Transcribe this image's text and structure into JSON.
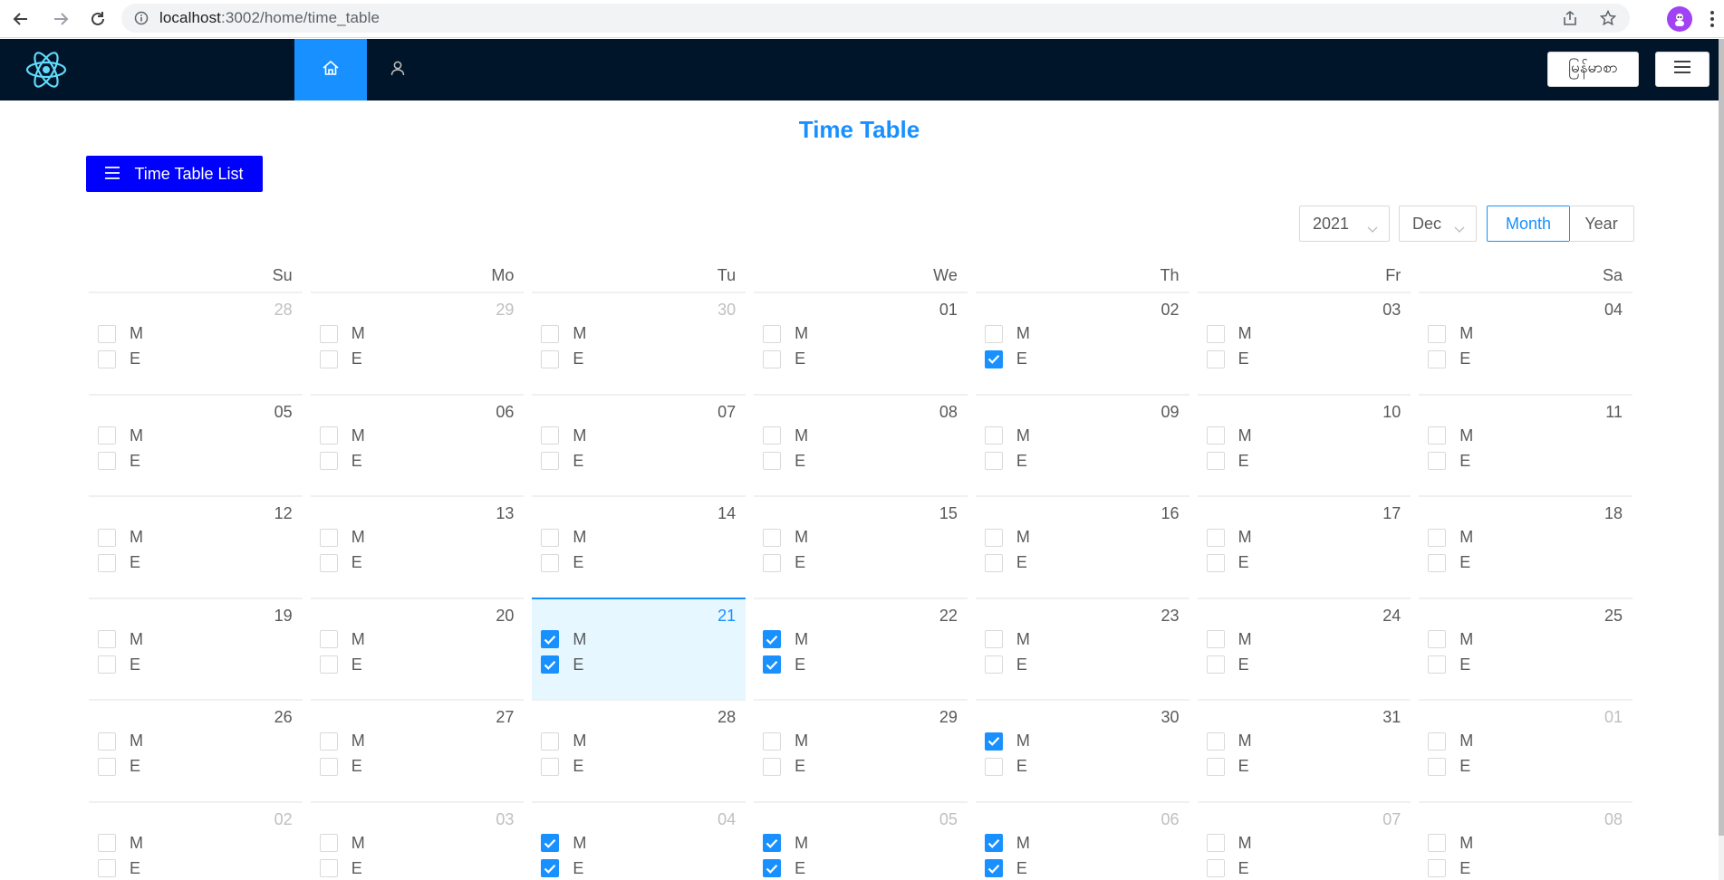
{
  "browser": {
    "url_host": "localhost",
    "url_rest": ":3002/home/time_table"
  },
  "header": {
    "language_label": "မြန်မာစာ"
  },
  "page": {
    "title": "Time Table",
    "list_button": "Time Table List"
  },
  "controls": {
    "year": "2021",
    "month": "Dec",
    "mode_month": "Month",
    "mode_year": "Year",
    "active_mode": "Month"
  },
  "calendar": {
    "weekdays": [
      "Su",
      "Mo",
      "Tu",
      "We",
      "Th",
      "Fr",
      "Sa"
    ],
    "shift_labels": [
      "M",
      "E"
    ],
    "today": "21",
    "weeks": [
      [
        {
          "day": "28",
          "current": false,
          "M": false,
          "E": false
        },
        {
          "day": "29",
          "current": false,
          "M": false,
          "E": false
        },
        {
          "day": "30",
          "current": false,
          "M": false,
          "E": false
        },
        {
          "day": "01",
          "current": true,
          "M": false,
          "E": false
        },
        {
          "day": "02",
          "current": true,
          "M": false,
          "E": true
        },
        {
          "day": "03",
          "current": true,
          "M": false,
          "E": false
        },
        {
          "day": "04",
          "current": true,
          "M": false,
          "E": false
        }
      ],
      [
        {
          "day": "05",
          "current": true,
          "M": false,
          "E": false
        },
        {
          "day": "06",
          "current": true,
          "M": false,
          "E": false
        },
        {
          "day": "07",
          "current": true,
          "M": false,
          "E": false
        },
        {
          "day": "08",
          "current": true,
          "M": false,
          "E": false
        },
        {
          "day": "09",
          "current": true,
          "M": false,
          "E": false
        },
        {
          "day": "10",
          "current": true,
          "M": false,
          "E": false
        },
        {
          "day": "11",
          "current": true,
          "M": false,
          "E": false
        }
      ],
      [
        {
          "day": "12",
          "current": true,
          "M": false,
          "E": false
        },
        {
          "day": "13",
          "current": true,
          "M": false,
          "E": false
        },
        {
          "day": "14",
          "current": true,
          "M": false,
          "E": false
        },
        {
          "day": "15",
          "current": true,
          "M": false,
          "E": false
        },
        {
          "day": "16",
          "current": true,
          "M": false,
          "E": false
        },
        {
          "day": "17",
          "current": true,
          "M": false,
          "E": false
        },
        {
          "day": "18",
          "current": true,
          "M": false,
          "E": false
        }
      ],
      [
        {
          "day": "19",
          "current": true,
          "M": false,
          "E": false
        },
        {
          "day": "20",
          "current": true,
          "M": false,
          "E": false
        },
        {
          "day": "21",
          "current": true,
          "M": true,
          "E": true
        },
        {
          "day": "22",
          "current": true,
          "M": true,
          "E": true
        },
        {
          "day": "23",
          "current": true,
          "M": false,
          "E": false
        },
        {
          "day": "24",
          "current": true,
          "M": false,
          "E": false
        },
        {
          "day": "25",
          "current": true,
          "M": false,
          "E": false
        }
      ],
      [
        {
          "day": "26",
          "current": true,
          "M": false,
          "E": false
        },
        {
          "day": "27",
          "current": true,
          "M": false,
          "E": false
        },
        {
          "day": "28",
          "current": true,
          "M": false,
          "E": false
        },
        {
          "day": "29",
          "current": true,
          "M": false,
          "E": false
        },
        {
          "day": "30",
          "current": true,
          "M": true,
          "E": false
        },
        {
          "day": "31",
          "current": true,
          "M": false,
          "E": false
        },
        {
          "day": "01",
          "current": false,
          "M": false,
          "E": false
        }
      ],
      [
        {
          "day": "02",
          "current": false,
          "M": false,
          "E": false
        },
        {
          "day": "03",
          "current": false,
          "M": false,
          "E": false
        },
        {
          "day": "04",
          "current": false,
          "M": true,
          "E": true
        },
        {
          "day": "05",
          "current": false,
          "M": true,
          "E": true
        },
        {
          "day": "06",
          "current": false,
          "M": true,
          "E": true
        },
        {
          "day": "07",
          "current": false,
          "M": false,
          "E": false
        },
        {
          "day": "08",
          "current": false,
          "M": false,
          "E": false
        }
      ]
    ]
  },
  "colors": {
    "header_bg": "#001529",
    "accent": "#1890ff",
    "list_button_bg": "#0000ff",
    "today_bg": "#e6f7ff"
  },
  "icons": {
    "logo": "react-logo-icon",
    "home": "home-icon",
    "user": "user-icon",
    "menu": "hamburger-icon"
  }
}
